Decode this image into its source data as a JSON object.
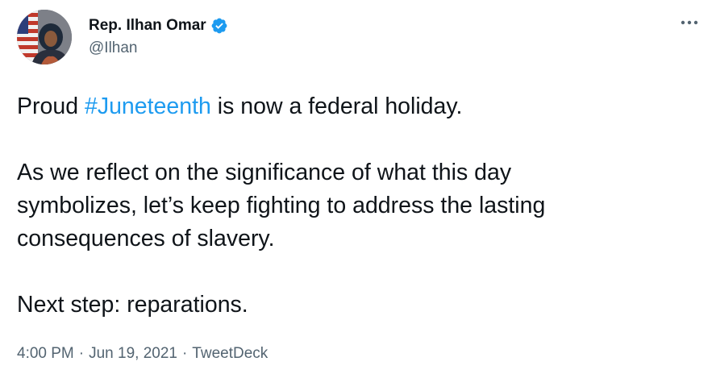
{
  "author": {
    "display_name": "Rep. Ilhan Omar",
    "handle": "@Ilhan",
    "verified": true,
    "verified_color": "#1d9bf0"
  },
  "more_icon": "more-horizontal-icon",
  "tweet": {
    "line1_before": "Proud ",
    "hashtag": "#Juneteenth",
    "line1_after": " is now a federal holiday.",
    "paragraph2_line1": "As we reflect on the significance of what this day",
    "paragraph2_line2": "symbolizes, let’s keep fighting to address the lasting",
    "paragraph2_line3": "consequences of slavery.",
    "paragraph3": "Next step: reparations."
  },
  "meta": {
    "time": "4:00 PM",
    "separator": "·",
    "date": "Jun 19, 2021",
    "source": "TweetDeck"
  },
  "colors": {
    "text": "#0f1419",
    "secondary": "#536471",
    "link": "#1d9bf0"
  }
}
